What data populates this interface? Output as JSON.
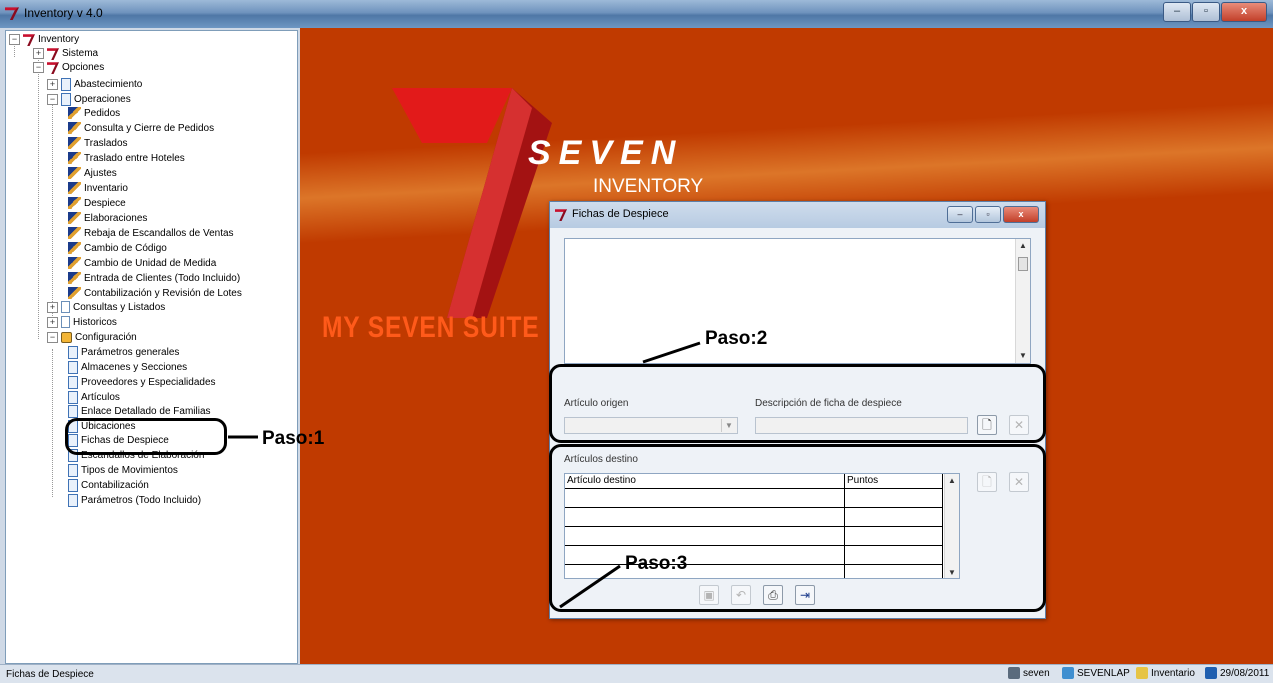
{
  "window": {
    "title": "Inventory v 4.0",
    "buttons": {
      "minimize": "–",
      "restore": "▫",
      "close": "x"
    }
  },
  "tree": {
    "root": "Inventory",
    "sistema": "Sistema",
    "opciones": "Opciones",
    "abastecimiento": "Abastecimiento",
    "operaciones": "Operaciones",
    "operaciones_items": [
      "Pedidos",
      "Consulta y Cierre de Pedidos",
      "Traslados",
      "Traslado entre Hoteles",
      "Ajustes",
      "Inventario",
      "Despiece",
      "Elaboraciones",
      "Rebaja de Escandallos de Ventas",
      "Cambio de Código",
      "Cambio de Unidad de Medida",
      "Entrada de Clientes (Todo Incluido)",
      "Contabilización y Revisión de Lotes"
    ],
    "consultas": "Consultas y Listados",
    "historicos": "Historicos",
    "configuracion": "Configuración",
    "configuracion_items": [
      "Parámetros generales",
      "Almacenes y Secciones",
      "Proveedores y Especialidades",
      "Artículos",
      "Enlace Detallado de Familias",
      "Ubicaciones",
      "Fichas de Despiece",
      "Escandallos de Elaboración",
      "Tipos de Movimientos",
      "Contabilización",
      "Parámetros (Todo Incluido)"
    ]
  },
  "branding": {
    "name": "SEVEN",
    "product": "INVENTORY",
    "suite": "MY SEVEN SUITE"
  },
  "dialog": {
    "title": "Fichas de Despiece",
    "origin_label": "Artículo origen",
    "description_label": "Descripción de ficha de despiece",
    "dest_section": "Artículos destino",
    "columns": [
      "Artículo destino",
      "Puntos"
    ],
    "rows": [
      [
        "",
        ""
      ],
      [
        "",
        ""
      ],
      [
        "",
        ""
      ],
      [
        "",
        ""
      ],
      [
        "",
        ""
      ]
    ]
  },
  "annotations": {
    "paso1": "Paso:1",
    "paso2": "Paso:2",
    "paso3": "Paso:3"
  },
  "statusbar": {
    "left": "Fichas de Despiece",
    "user": "seven",
    "machine": "SEVENLAP",
    "module": "Inventario",
    "date": "29/08/2011"
  }
}
